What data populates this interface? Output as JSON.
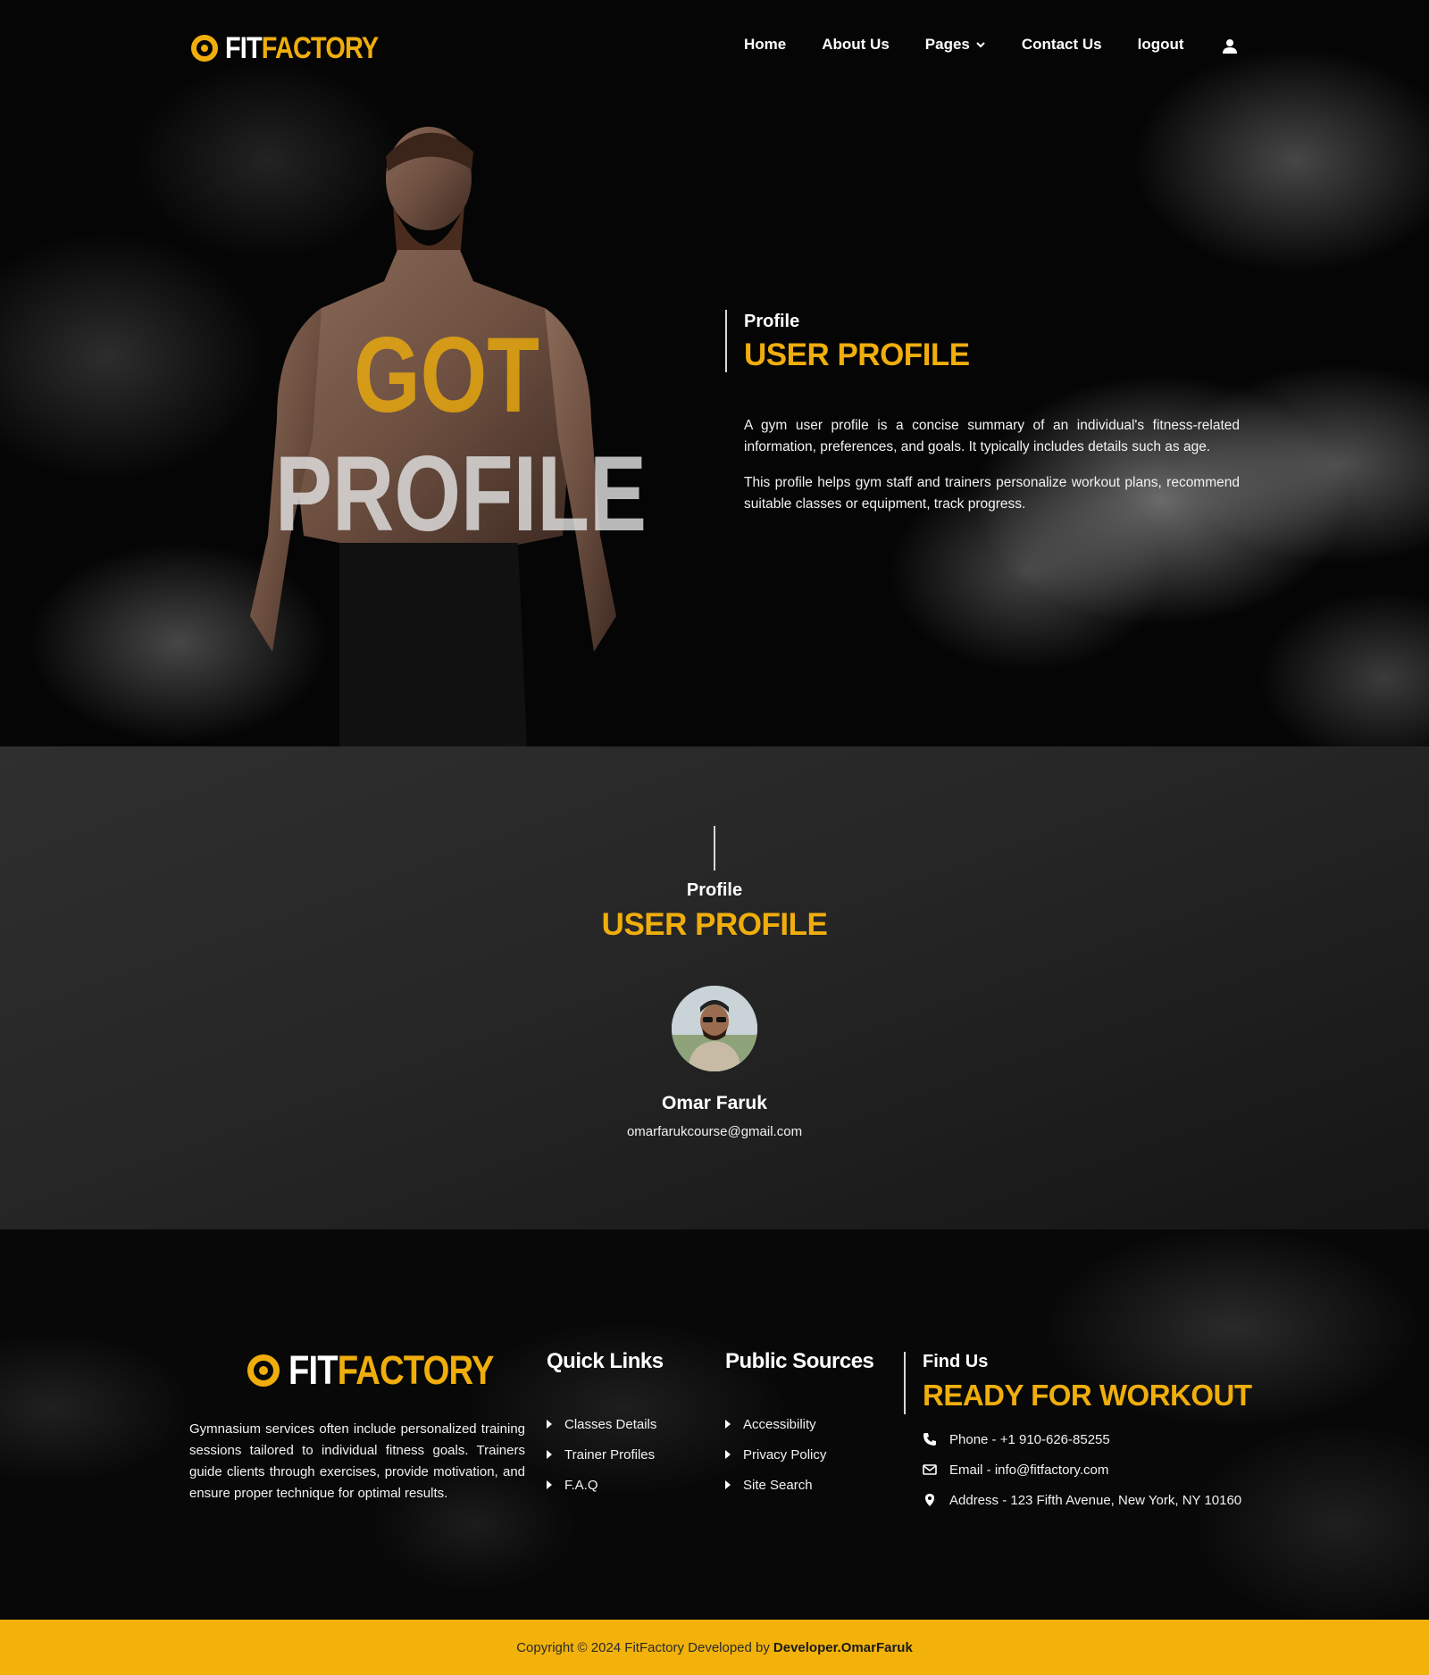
{
  "brand": {
    "fit": "FIT",
    "factory": "FACTORY",
    "accent": "#f0ae0c"
  },
  "nav": {
    "items": [
      "Home",
      "About Us",
      "Pages",
      "Contact Us",
      "logout"
    ],
    "pages_dropdown_icon": "chevron-down-icon",
    "user_icon": "user-icon"
  },
  "hero": {
    "big_word_1": "GOT",
    "big_word_2": "PROFILE",
    "kicker": "Profile",
    "title": "USER PROFILE",
    "paragraph_1": "A gym user profile is a concise summary of an individual's fitness-related information, preferences, and goals. It typically includes details such as age.",
    "paragraph_2": "This profile helps gym staff and trainers personalize workout plans, recommend suitable classes or equipment, track progress."
  },
  "profile": {
    "kicker": "Profile",
    "title": "USER PROFILE",
    "name": "Omar Faruk",
    "email": "omarfarukcourse@gmail.com"
  },
  "footer": {
    "about": "Gymnasium services often include personalized training sessions tailored to individual fitness goals. Trainers guide clients through exercises, provide motivation, and ensure proper technique for optimal results.",
    "quick_links": {
      "title": "Quick Links",
      "items": [
        "Classes Details",
        "Trainer Profiles",
        "F.A.Q"
      ]
    },
    "public_sources": {
      "title": "Public Sources",
      "items": [
        "Accessibility",
        "Privacy Policy",
        "Site Search"
      ]
    },
    "find_us": {
      "kicker": "Find Us",
      "title": "READY FOR WORKOUT",
      "phone": "Phone - +1 910-626-85255",
      "email": "Email - info@fitfactory.com",
      "address": "Address - 123 Fifth Avenue, New York, NY 10160"
    }
  },
  "copyright": {
    "text": "Copyright © 2024 FitFactory Developed by",
    "developer": "Developer.OmarFaruk"
  }
}
